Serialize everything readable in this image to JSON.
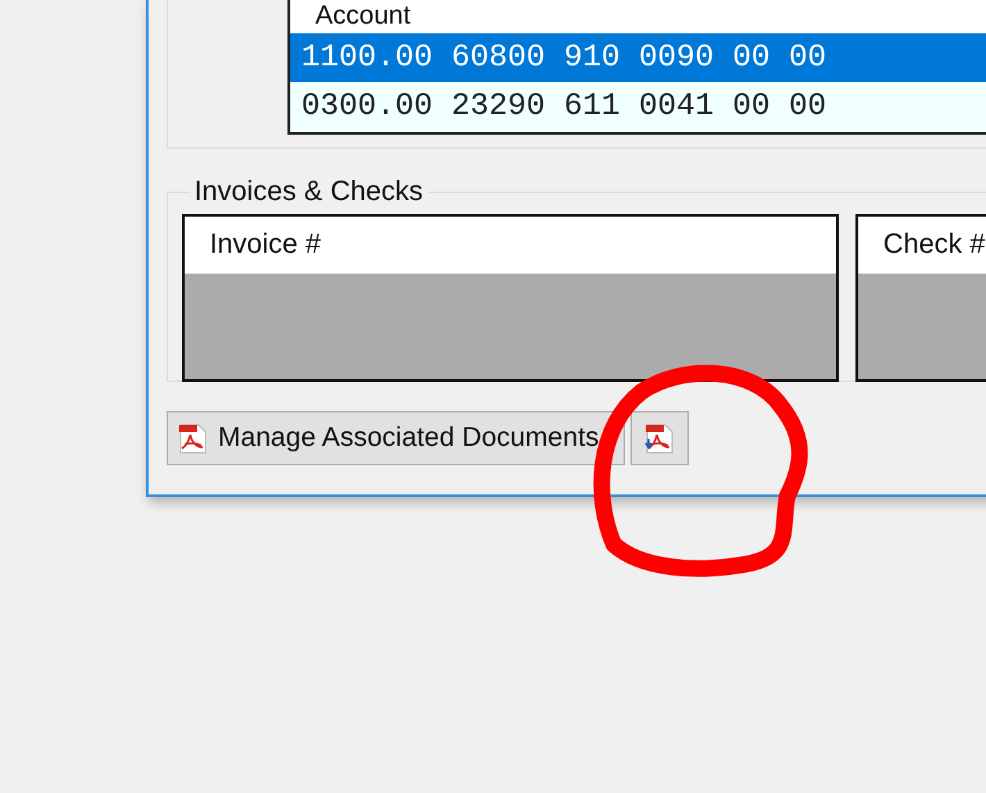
{
  "accounts": {
    "header": "Account",
    "rows": [
      {
        "text": "1100.00 60800 910 0090 00 00",
        "selected": true
      },
      {
        "text": "0300.00 23290 611 0041 00 00",
        "selected": false
      }
    ]
  },
  "invoices_checks": {
    "title": "Invoices & Checks",
    "grids": [
      {
        "header": "Invoice #"
      },
      {
        "header": "Check #"
      }
    ]
  },
  "buttons": [
    {
      "kind": "text",
      "label": "Manage Associated Documents"
    },
    {
      "kind": "icon"
    }
  ],
  "annotation": {
    "kind": "circle"
  }
}
